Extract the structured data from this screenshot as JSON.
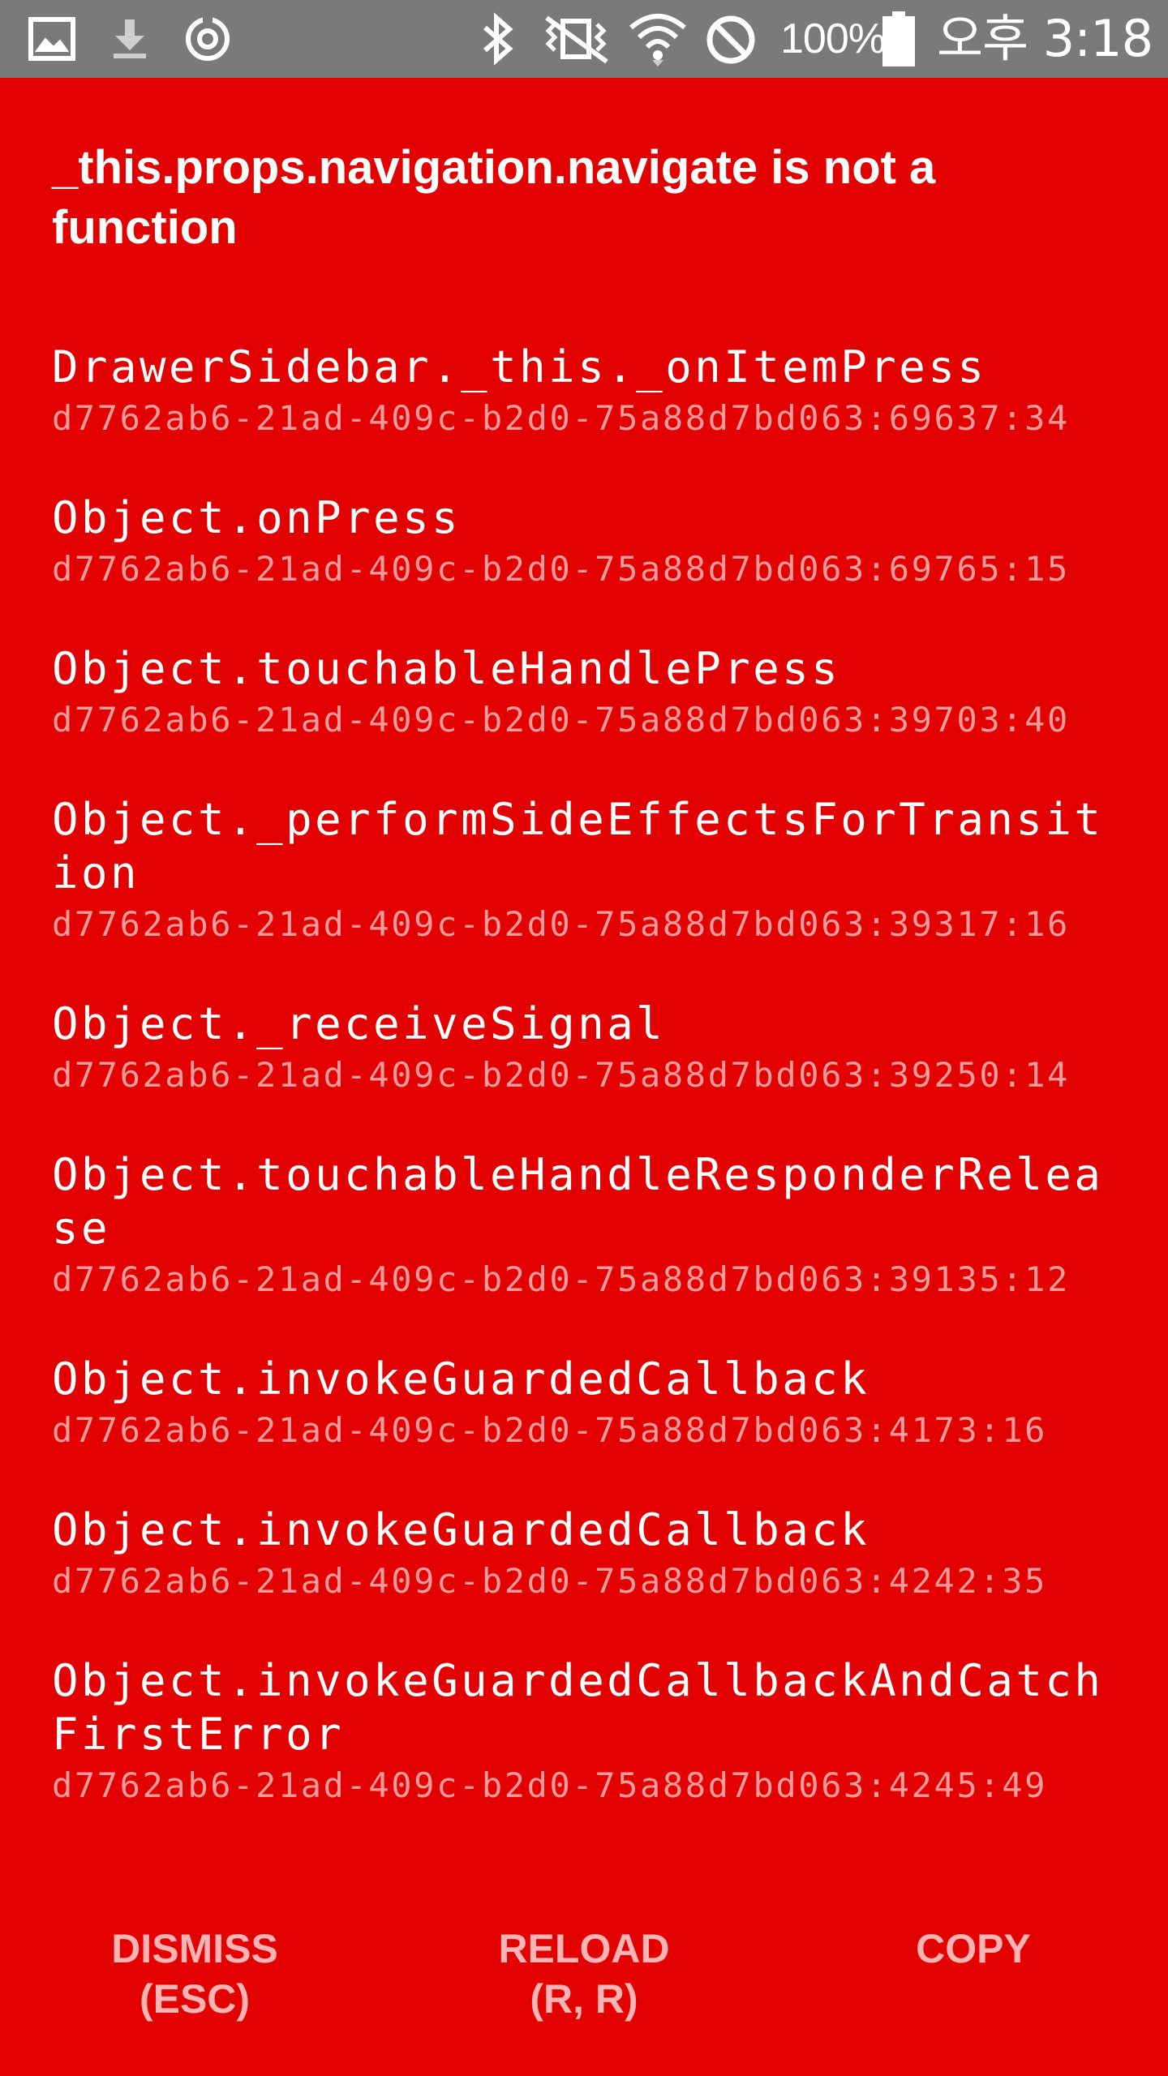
{
  "status_bar": {
    "battery_percent": "100%",
    "time": "오후 3:18",
    "icons": [
      "gallery-icon",
      "download-icon",
      "sync-icon",
      "bluetooth-icon",
      "vibrate-icon",
      "wifi-icon",
      "do-not-disturb-icon",
      "battery-icon"
    ]
  },
  "error": {
    "title": "_this.props.navigation.navigate is not a function"
  },
  "stack_frames": [
    {
      "method": "DrawerSidebar._this._onItemPress",
      "location": "d7762ab6-21ad-409c-b2d0-75a88d7bd063:69637:34"
    },
    {
      "method": "Object.onPress",
      "location": "d7762ab6-21ad-409c-b2d0-75a88d7bd063:69765:15"
    },
    {
      "method": "Object.touchableHandlePress",
      "location": "d7762ab6-21ad-409c-b2d0-75a88d7bd063:39703:40"
    },
    {
      "method": "Object._performSideEffectsForTransition",
      "location": "d7762ab6-21ad-409c-b2d0-75a88d7bd063:39317:16"
    },
    {
      "method": "Object._receiveSignal",
      "location": "d7762ab6-21ad-409c-b2d0-75a88d7bd063:39250:14"
    },
    {
      "method": "Object.touchableHandleResponderRelease",
      "location": "d7762ab6-21ad-409c-b2d0-75a88d7bd063:39135:12"
    },
    {
      "method": "Object.invokeGuardedCallback",
      "location": "d7762ab6-21ad-409c-b2d0-75a88d7bd063:4173:16"
    },
    {
      "method": "Object.invokeGuardedCallback",
      "location": "d7762ab6-21ad-409c-b2d0-75a88d7bd063:4242:35"
    },
    {
      "method": "Object.invokeGuardedCallbackAndCatchFirstError",
      "location": "d7762ab6-21ad-409c-b2d0-75a88d7bd063:4245:49"
    }
  ],
  "buttons": {
    "dismiss": {
      "label": "DISMISS",
      "shortcut": "(ESC)"
    },
    "reload": {
      "label": "RELOAD",
      "shortcut": "(R, R)"
    },
    "copy": {
      "label": "COPY"
    }
  },
  "colors": {
    "background": "#e30000",
    "status_bar": "#7a7a7a",
    "frame_location": "#ff9b9b",
    "button_text": "#ffb3b3"
  }
}
